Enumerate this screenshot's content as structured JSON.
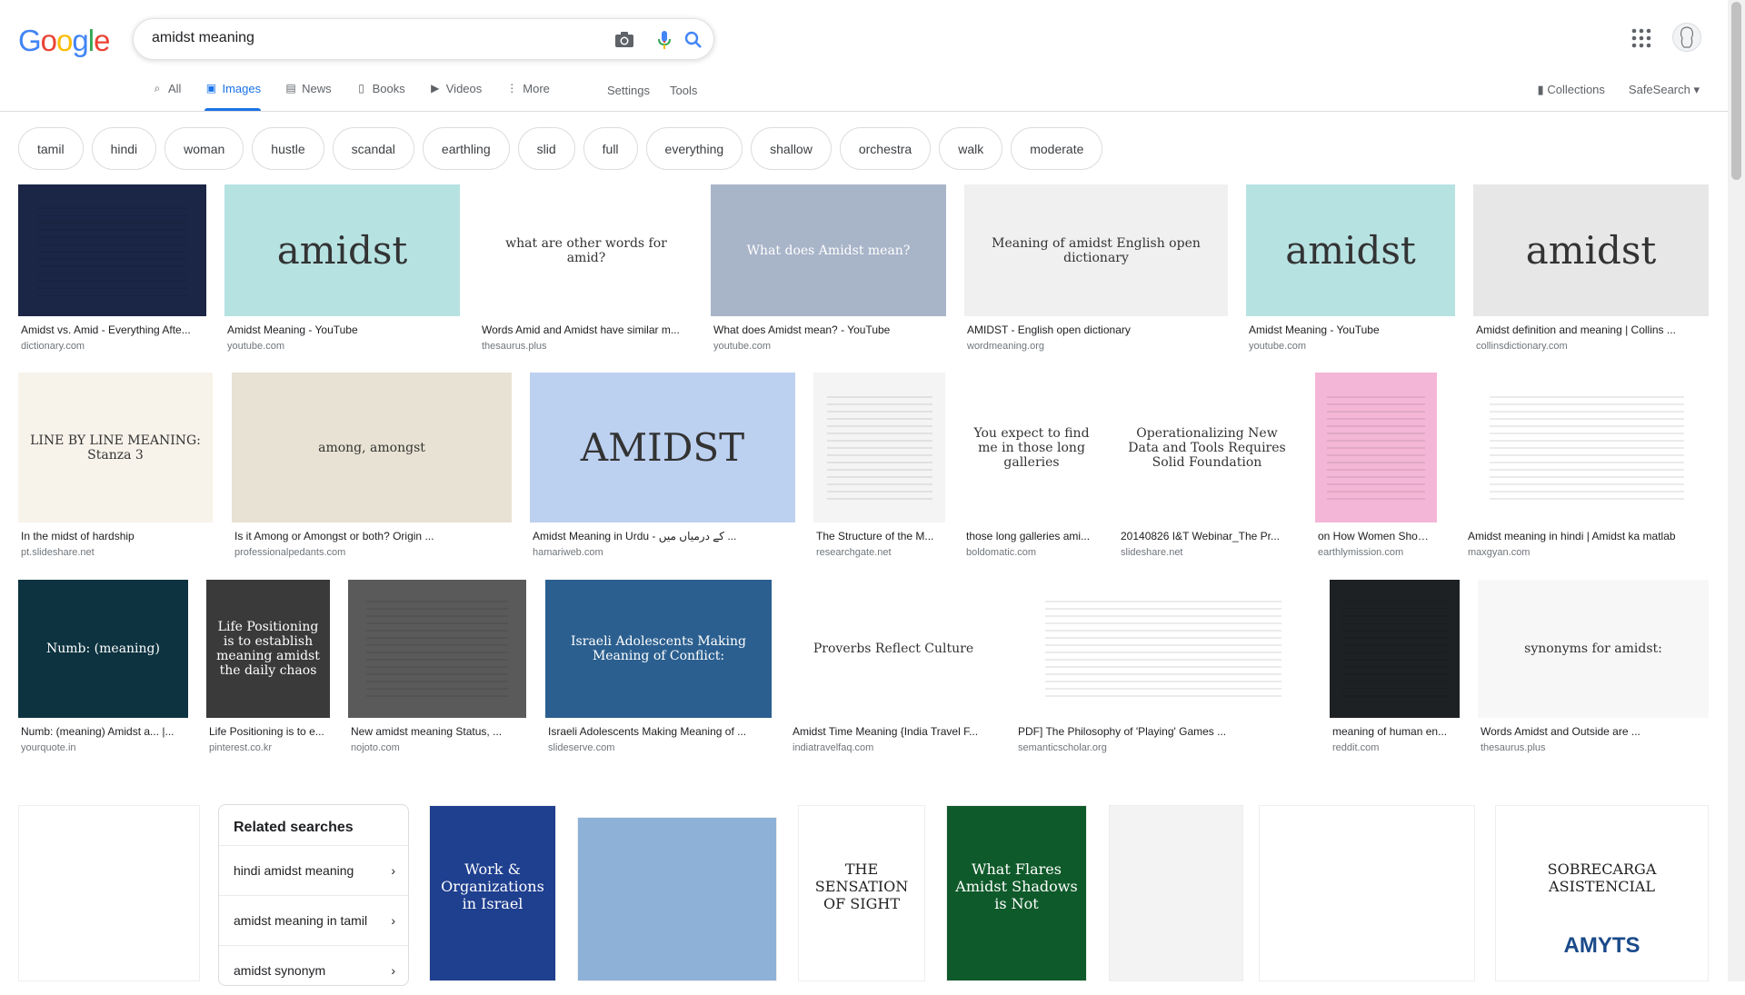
{
  "logo": "Google",
  "search": {
    "query": "amidst meaning"
  },
  "tabs": [
    {
      "label": "All",
      "icon": "search-icon"
    },
    {
      "label": "Images",
      "icon": "image-icon"
    },
    {
      "label": "News",
      "icon": "news-icon"
    },
    {
      "label": "Books",
      "icon": "book-icon"
    },
    {
      "label": "Videos",
      "icon": "video-icon"
    },
    {
      "label": "More",
      "icon": "more-vert-icon"
    }
  ],
  "tools": {
    "settings": "Settings",
    "tools": "Tools"
  },
  "right": {
    "collections": "Collections",
    "safesearch": "SafeSearch ▾"
  },
  "chips": [
    "tamil",
    "hindi",
    "woman",
    "hustle",
    "scandal",
    "earthling",
    "slid",
    "full",
    "everything",
    "shallow",
    "orchestra",
    "walk",
    "moderate"
  ],
  "results": [
    {
      "title": "Amidst vs. Amid - Everything Afte...",
      "source": "dictionary.com",
      "thumb_text": ""
    },
    {
      "title": "Amidst Meaning - YouTube",
      "source": "youtube.com",
      "thumb_text": "amidst"
    },
    {
      "title": "Words Amid and Amidst have similar m...",
      "source": "thesaurus.plus",
      "thumb_text": "what are other words for amid?"
    },
    {
      "title": "What does Amidst mean? - YouTube",
      "source": "youtube.com",
      "thumb_text": "What does Amidst mean?"
    },
    {
      "title": "AMIDST - English open dictionary",
      "source": "wordmeaning.org",
      "thumb_text": "Meaning of amidst English open dictionary"
    },
    {
      "title": "Amidst Meaning - YouTube",
      "source": "youtube.com",
      "thumb_text": "amidst"
    },
    {
      "title": "Amidst definition and meaning | Collins ...",
      "source": "collinsdictionary.com",
      "thumb_text": "amidst"
    },
    {
      "title": "In the midst of hardship",
      "source": "pt.slideshare.net",
      "thumb_text": "LINE BY LINE MEANING: Stanza 3"
    },
    {
      "title": "Is it Among or Amongst or both? Origin ...",
      "source": "professionalpedants.com",
      "thumb_text": "among, amongst"
    },
    {
      "title": "Amidst Meaning in Urdu - کے درمیاں میں ...",
      "source": "hamariweb.com",
      "thumb_text": "AMIDST"
    },
    {
      "title": "The Structure of the M...",
      "source": "researchgate.net",
      "thumb_text": ""
    },
    {
      "title": "those long galleries ami...",
      "source": "boldomatic.com",
      "thumb_text": "You expect to find me in those long galleries"
    },
    {
      "title": "20140826 I&T Webinar_The Pr...",
      "source": "slideshare.net",
      "thumb_text": "Operationalizing New Data and Tools Requires Solid Foundation"
    },
    {
      "title": "on How Women Shoul...",
      "source": "earthlymission.com",
      "thumb_text": ""
    },
    {
      "title": "Amidst meaning in hindi | Amidst ka matlab",
      "source": "maxgyan.com",
      "thumb_text": ""
    },
    {
      "title": "Numb: (meaning) Amidst a... |...",
      "source": "yourquote.in",
      "thumb_text": "Numb: (meaning)"
    },
    {
      "title": "Life Positioning is to e...",
      "source": "pinterest.co.kr",
      "thumb_text": "Life Positioning is to establish meaning amidst the daily chaos"
    },
    {
      "title": "New amidst meaning Status, ...",
      "source": "nojoto.com",
      "thumb_text": ""
    },
    {
      "title": "Israeli Adolescents Making Meaning of ...",
      "source": "slideserve.com",
      "thumb_text": "Israeli Adolescents Making Meaning of Conflict:"
    },
    {
      "title": "Amidst Time Meaning {India Travel F...",
      "source": "indiatravelfaq.com",
      "thumb_text": "Proverbs Reflect Culture"
    },
    {
      "title": "PDF] The Philosophy of 'Playing' Games ...",
      "source": "semanticscholar.org",
      "thumb_text": ""
    },
    {
      "title": "meaning of human en...",
      "source": "reddit.com",
      "thumb_text": ""
    },
    {
      "title": "Words Amidst and Outside are ...",
      "source": "thesaurus.plus",
      "thumb_text": "synonyms for amidst:"
    }
  ],
  "related": {
    "title": "Related searches",
    "items": [
      "hindi amidst meaning",
      "amidst meaning in tamil",
      "amidst synonym"
    ]
  },
  "row4_thumbs": [
    "Work & Organizations in Israel",
    "THE SENSATION OF SIGHT",
    "What Flares Amidst Shadows is Not",
    "SOBRECARGA ASISTENCIAL",
    "AMYTS"
  ],
  "colors": {
    "accent": "#1a73e8",
    "text": "#202124",
    "muted": "#70757a"
  }
}
